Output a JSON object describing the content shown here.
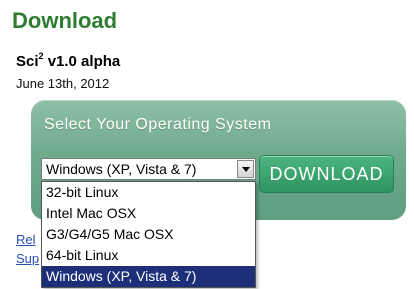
{
  "page": {
    "title": "Download"
  },
  "product": {
    "name_prefix": "Sci",
    "superscript": "2",
    "name_suffix": " v1.0 alpha",
    "date": "June 13th, 2012"
  },
  "panel": {
    "heading": "Select Your Operating System",
    "selected_os": "Windows (XP, Vista & 7)",
    "download_label": "DOWNLOAD",
    "colors": {
      "panel": "#6faa8d",
      "button": "#3aa36f"
    }
  },
  "dropdown": {
    "options": [
      "32-bit Linux",
      "Intel Mac OSX",
      "G3/G4/G5 Mac OSX",
      "64-bit Linux",
      "Windows (XP, Vista & 7)"
    ],
    "highlighted_index": 4
  },
  "links": {
    "release_partial": "Rel",
    "support_partial": "Sup"
  }
}
